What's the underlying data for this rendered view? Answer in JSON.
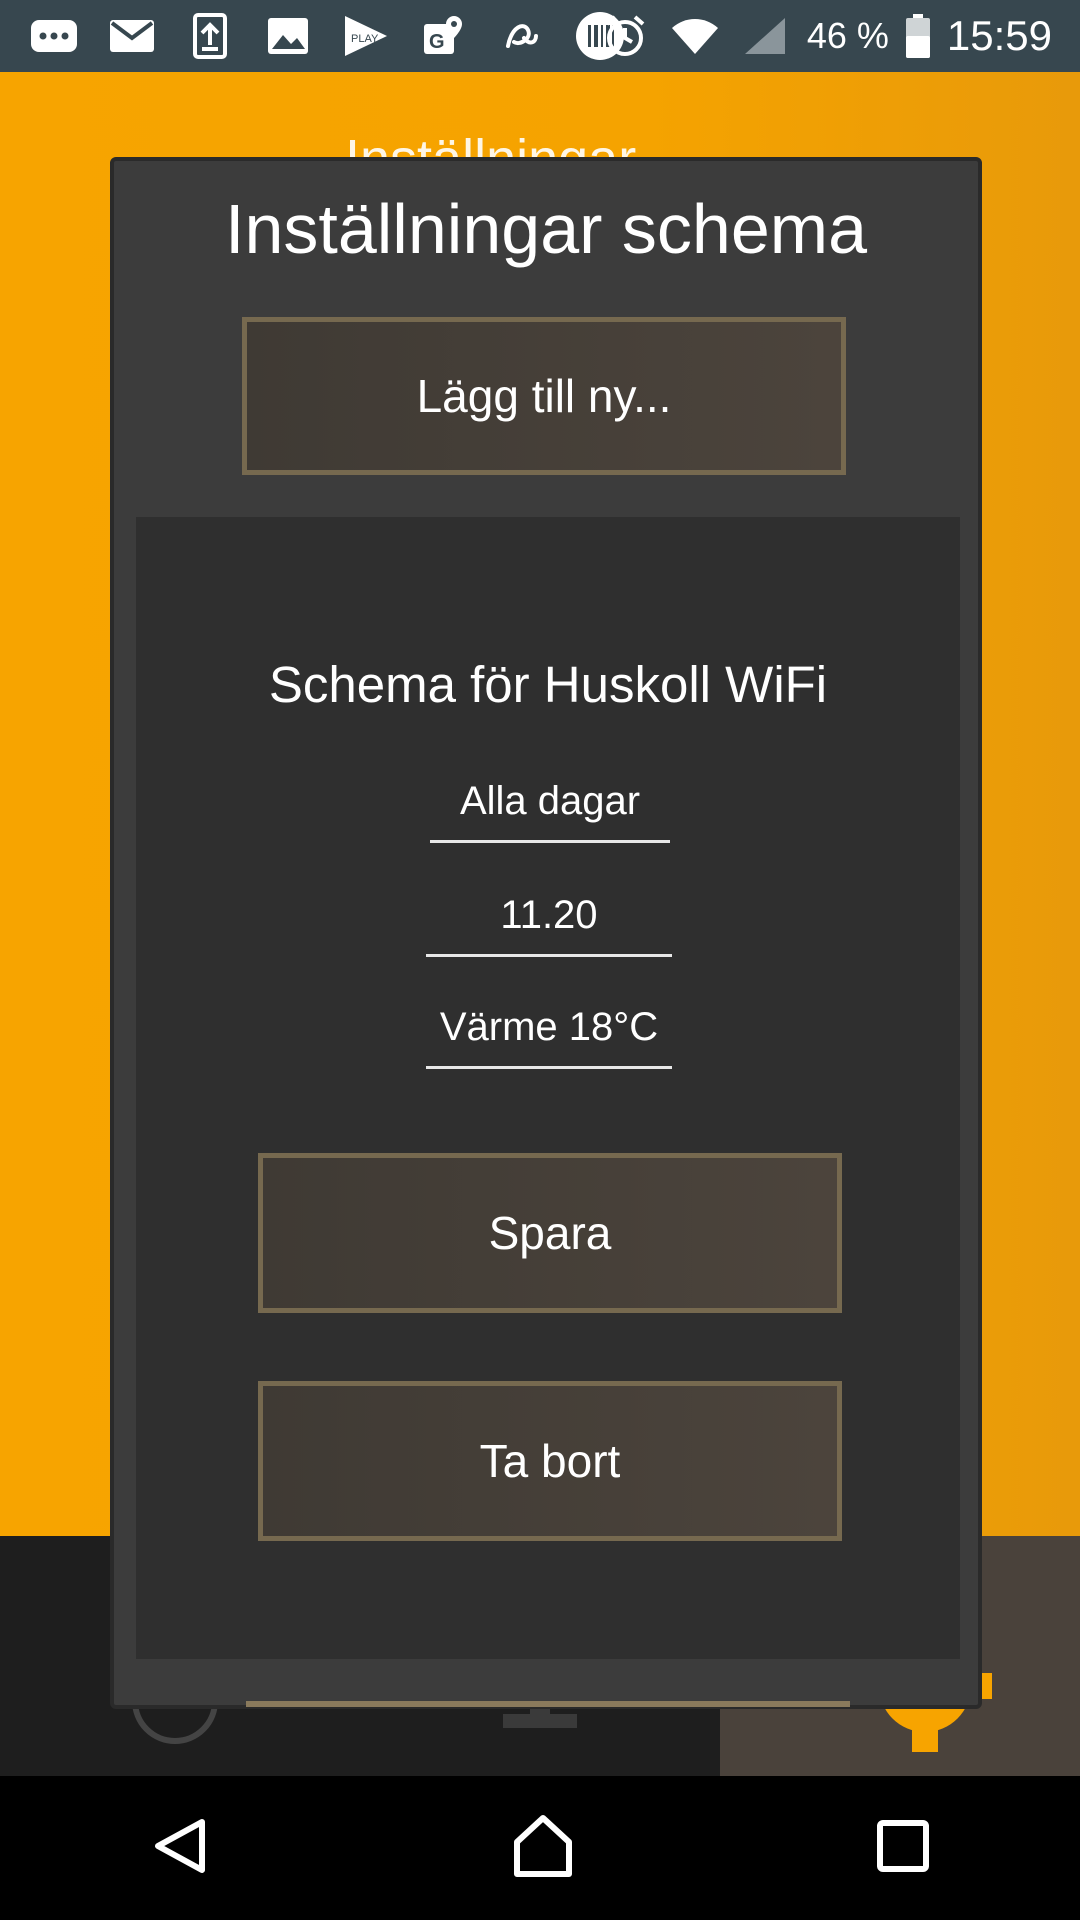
{
  "status_bar": {
    "battery_percent": "46 %",
    "time": "15:59",
    "notification_icons": [
      "chat-icon",
      "mail-icon",
      "upload-icon",
      "image-icon",
      "play-store-icon",
      "maps-icon",
      "app-icon",
      "barcode-icon"
    ]
  },
  "background": {
    "title_partial": "Inställningar"
  },
  "dialog": {
    "title": "Inställningar schema",
    "add_button": "Lägg till ny...",
    "schedule": {
      "heading": "Schema för Huskoll WiFi",
      "days": "Alla dagar",
      "time": "11.20",
      "mode": "Värme 18°C"
    },
    "save_button": "Spara",
    "delete_button": "Ta bort"
  },
  "colors": {
    "statusbar": "#37474f",
    "app_background": "#f7a400",
    "dialog_background": "#3c3c3c",
    "panel_background": "#2f2f2f",
    "button_border": "#76694f"
  }
}
